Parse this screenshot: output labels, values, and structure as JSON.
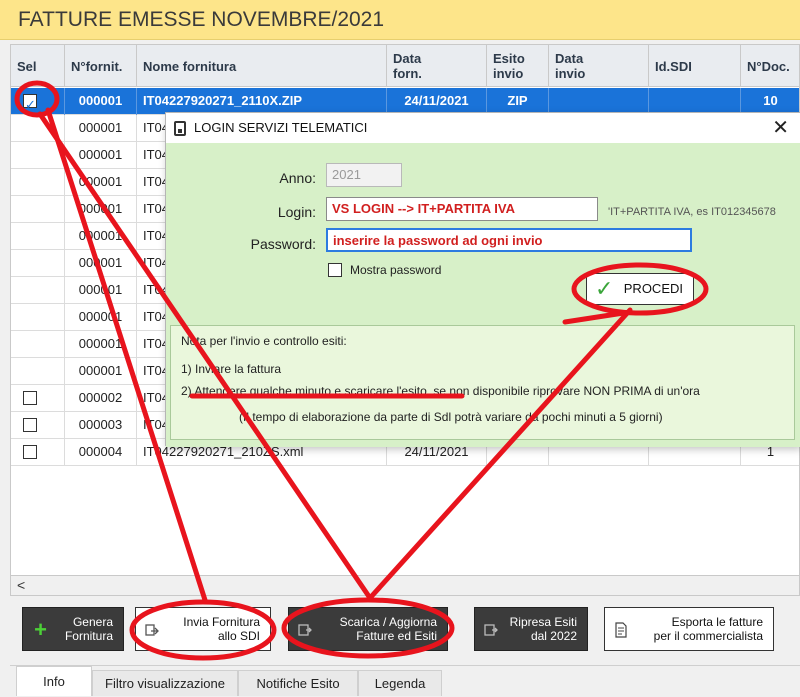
{
  "window": {
    "title": "FATTURE EMESSE NOVEMBRE/2021"
  },
  "grid": {
    "columns": [
      {
        "key": "sel",
        "label": "Sel"
      },
      {
        "key": "nfornit",
        "label": "N°fornit."
      },
      {
        "key": "nome",
        "label": "Nome fornitura"
      },
      {
        "key": "data_forn",
        "label": "Data forn."
      },
      {
        "key": "esito",
        "label": "Esito invio"
      },
      {
        "key": "data_invio",
        "label": "Data invio"
      },
      {
        "key": "idsdi",
        "label": "Id.SDI"
      },
      {
        "key": "ndoc",
        "label": "N°Doc."
      }
    ],
    "rows": [
      {
        "checked": true,
        "has_checkbox": true,
        "nfornit": "000001",
        "nome": "IT04227920271_2110X.ZIP",
        "data_forn": "24/11/2021",
        "esito": "ZIP",
        "data_invio": "",
        "idsdi": "",
        "ndoc": "10"
      },
      {
        "checked": false,
        "has_checkbox": false,
        "nfornit": "000001",
        "nome": "IT04",
        "data_forn": "",
        "esito": "",
        "data_invio": "",
        "idsdi": "",
        "ndoc": ""
      },
      {
        "checked": false,
        "has_checkbox": false,
        "nfornit": "000001",
        "nome": "IT04",
        "data_forn": "",
        "esito": "",
        "data_invio": "",
        "idsdi": "",
        "ndoc": ""
      },
      {
        "checked": false,
        "has_checkbox": false,
        "nfornit": "000001",
        "nome": "IT04",
        "data_forn": "",
        "esito": "",
        "data_invio": "",
        "idsdi": "",
        "ndoc": ""
      },
      {
        "checked": false,
        "has_checkbox": false,
        "nfornit": "000001",
        "nome": "IT04",
        "data_forn": "",
        "esito": "",
        "data_invio": "",
        "idsdi": "",
        "ndoc": ""
      },
      {
        "checked": false,
        "has_checkbox": false,
        "nfornit": "000001",
        "nome": "IT04",
        "data_forn": "",
        "esito": "",
        "data_invio": "",
        "idsdi": "",
        "ndoc": ""
      },
      {
        "checked": false,
        "has_checkbox": false,
        "nfornit": "000001",
        "nome": "IT04",
        "data_forn": "",
        "esito": "",
        "data_invio": "",
        "idsdi": "",
        "ndoc": ""
      },
      {
        "checked": false,
        "has_checkbox": false,
        "nfornit": "000001",
        "nome": "IT04",
        "data_forn": "",
        "esito": "",
        "data_invio": "",
        "idsdi": "",
        "ndoc": ""
      },
      {
        "checked": false,
        "has_checkbox": false,
        "nfornit": "000001",
        "nome": "IT04",
        "data_forn": "",
        "esito": "",
        "data_invio": "",
        "idsdi": "",
        "ndoc": ""
      },
      {
        "checked": false,
        "has_checkbox": false,
        "nfornit": "000001",
        "nome": "IT04",
        "data_forn": "",
        "esito": "",
        "data_invio": "",
        "idsdi": "",
        "ndoc": ""
      },
      {
        "checked": false,
        "has_checkbox": false,
        "nfornit": "000001",
        "nome": "IT04",
        "data_forn": "",
        "esito": "",
        "data_invio": "",
        "idsdi": "",
        "ndoc": ""
      },
      {
        "checked": false,
        "has_checkbox": true,
        "nfornit": "000002",
        "nome": "IT04",
        "data_forn": "",
        "esito": "",
        "data_invio": "",
        "idsdi": "",
        "ndoc": ""
      },
      {
        "checked": false,
        "has_checkbox": true,
        "nfornit": "000003",
        "nome": "IT04",
        "data_forn": "",
        "esito": "",
        "data_invio": "",
        "idsdi": "",
        "ndoc": ""
      },
      {
        "checked": false,
        "has_checkbox": true,
        "nfornit": "000004",
        "nome": "IT04227920271_210ZS.xml",
        "data_forn": "24/11/2021",
        "esito": "",
        "data_invio": "",
        "idsdi": "",
        "ndoc": "1"
      }
    ],
    "scroll_left": "<"
  },
  "toolbar": {
    "genera": "Genera\nFornitura",
    "invia": "Invia Fornitura\nallo SDI",
    "scarica": "Scarica / Aggiorna\nFatture ed Esiti",
    "ripresa": "Ripresa Esiti\ndal  2022",
    "esporta": "Esporta le fatture\nper il commercialista"
  },
  "tabs": [
    "Info",
    "Filtro visualizzazione",
    "Notifiche Esito",
    "Legenda"
  ],
  "dialog": {
    "title": "LOGIN SERVIZI TELEMATICI",
    "close": "✕",
    "anno_label": "Anno:",
    "anno_value": "2021",
    "login_label": "Login:",
    "login_value": "VS LOGIN --> IT+PARTITA IVA",
    "login_hint": "'IT+PARTITA IVA, es IT012345678",
    "password_label": "Password:",
    "password_value": "inserire la password ad ogni invio",
    "mostra_password": "Mostra password",
    "procedi": "PROCEDI",
    "note": {
      "title": "Nota per l'invio e controllo esiti:",
      "line1": "1) Inviare la fattura",
      "line2": "2) Attendere qualche minuto e scaricare l'esito, se non disponibile riprovare NON PRIMA di un'ora",
      "line3": "(Il tempo di elaborazione da parte di Sdl potrà variare da pochi minuti a 5 giorni)"
    }
  },
  "colors": {
    "title_bar": "#fde58a",
    "selection": "#1a73d9",
    "annotation": "#e8141d",
    "dialog_body": "#d7f0c8",
    "login_text": "#d11f1f"
  }
}
